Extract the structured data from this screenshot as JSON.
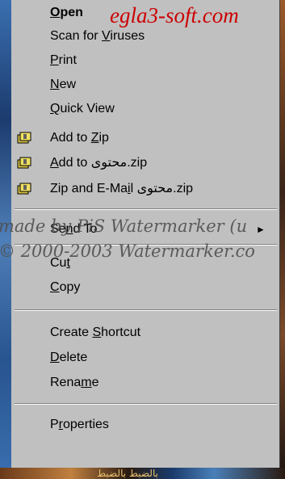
{
  "background": {
    "bottom_text": "بالضبط بالضبط"
  },
  "watermarks": {
    "top": "egla3-soft.com",
    "line1": "made by PiS Watermarker (u",
    "line2": "© 2000-2003 Watermarker.co"
  },
  "menu": {
    "items": [
      {
        "key": "open",
        "pre": "",
        "acc": "O",
        "post": "pen",
        "bold": true,
        "icon": ""
      },
      {
        "key": "scan",
        "pre": "Scan for ",
        "acc": "V",
        "post": "iruses",
        "bold": false,
        "icon": ""
      },
      {
        "key": "print",
        "pre": "",
        "acc": "P",
        "post": "rint",
        "bold": false,
        "icon": ""
      },
      {
        "key": "new",
        "pre": "",
        "acc": "N",
        "post": "ew",
        "bold": false,
        "icon": ""
      },
      {
        "key": "quickview",
        "pre": "",
        "acc": "Q",
        "post": "uick View",
        "bold": false,
        "icon": ""
      },
      {
        "key": "addzip",
        "pre": "Add to ",
        "acc": "Z",
        "post": "ip",
        "bold": false,
        "icon": "winzip-icon"
      },
      {
        "key": "addtozipname",
        "pre": "",
        "acc": "A",
        "post": "dd to محتوى.zip",
        "bold": false,
        "icon": "winzip-icon"
      },
      {
        "key": "zipemail",
        "pre": "Zip and E-Ma",
        "acc": "i",
        "post": "l محتوى.zip",
        "bold": false,
        "icon": "winzip-icon"
      },
      {
        "key": "sendto",
        "pre": "Se",
        "acc": "n",
        "post": "d To",
        "bold": false,
        "icon": ""
      },
      {
        "key": "cut",
        "pre": "Cu",
        "acc": "t",
        "post": "",
        "bold": false,
        "icon": ""
      },
      {
        "key": "copy",
        "pre": "",
        "acc": "C",
        "post": "opy",
        "bold": false,
        "icon": ""
      },
      {
        "key": "shortcut",
        "pre": "Create ",
        "acc": "S",
        "post": "hortcut",
        "bold": false,
        "icon": ""
      },
      {
        "key": "delete",
        "pre": "",
        "acc": "D",
        "post": "elete",
        "bold": false,
        "icon": ""
      },
      {
        "key": "rename",
        "pre": "Rena",
        "acc": "m",
        "post": "e",
        "bold": false,
        "icon": ""
      },
      {
        "key": "properties",
        "pre": "P",
        "acc": "r",
        "post": "operties",
        "bold": false,
        "icon": ""
      }
    ],
    "submenu_arrow": "►"
  }
}
